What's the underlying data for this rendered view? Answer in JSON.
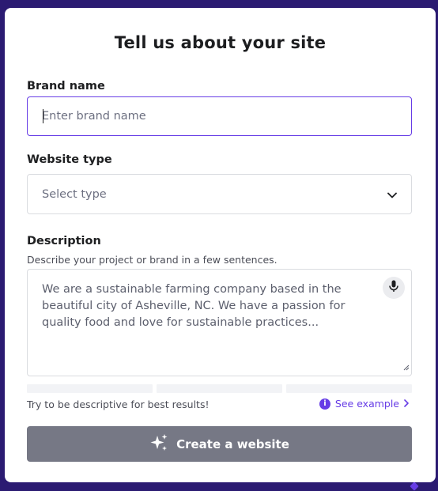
{
  "form": {
    "title": "Tell us about your site",
    "brand": {
      "label": "Brand name",
      "placeholder": "Enter brand name",
      "value": ""
    },
    "website_type": {
      "label": "Website type",
      "selected": "Select type"
    },
    "description": {
      "label": "Description",
      "hint": "Describe your project or brand in a few sentences.",
      "placeholder": "We are a sustainable farming company based in the beautiful city of Asheville, NC. We have a passion for quality food and love for sustainable practices..."
    },
    "tip": "Try to be descriptive for best results!",
    "see_example": "See example",
    "submit_label": "Create a website"
  },
  "icons": {
    "dropdown": "chevron-down-icon",
    "mic": "microphone-icon",
    "info": "info-icon",
    "link_arrow": "chevron-right-icon",
    "sparkles": "sparkles-icon"
  },
  "colors": {
    "background": "#2b1b72",
    "accent": "#673de6",
    "button_disabled": "#767885",
    "card": "#ffffff"
  }
}
